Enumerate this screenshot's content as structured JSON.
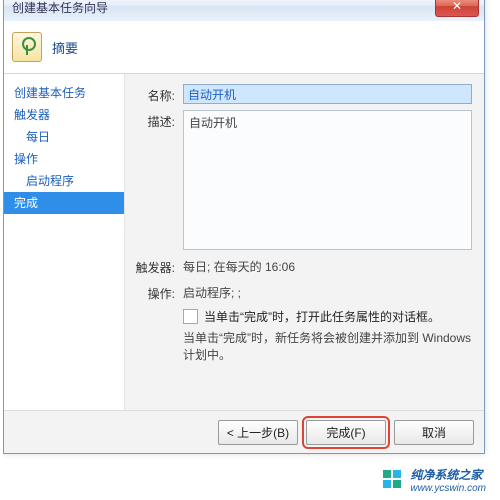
{
  "window": {
    "title": "创建基本任务向导"
  },
  "header": {
    "heading": "摘要"
  },
  "sidebar": {
    "items": [
      {
        "label": "创建基本任务",
        "sub": false,
        "selected": false
      },
      {
        "label": "触发器",
        "sub": false,
        "selected": false
      },
      {
        "label": "每日",
        "sub": true,
        "selected": false
      },
      {
        "label": "操作",
        "sub": false,
        "selected": false
      },
      {
        "label": "启动程序",
        "sub": true,
        "selected": false
      },
      {
        "label": "完成",
        "sub": false,
        "selected": true
      }
    ]
  },
  "form": {
    "name_label": "名称:",
    "name_value": "自动开机",
    "desc_label": "描述:",
    "desc_value": "自动开机",
    "trigger_label": "触发器:",
    "trigger_value": "每日; 在每天的 16:06",
    "action_label": "操作:",
    "action_value": "启动程序; ;",
    "checkbox_label": "当单击“完成”时，打开此任务属性的对话框。",
    "note": "当单击“完成”时，新任务将会被创建并添加到 Windows 计划中。"
  },
  "buttons": {
    "back": "< 上一步(B)",
    "finish": "完成(F)",
    "cancel": "取消"
  },
  "watermark": {
    "text": "纯净系统之家",
    "url": "www.ycswin.com"
  }
}
